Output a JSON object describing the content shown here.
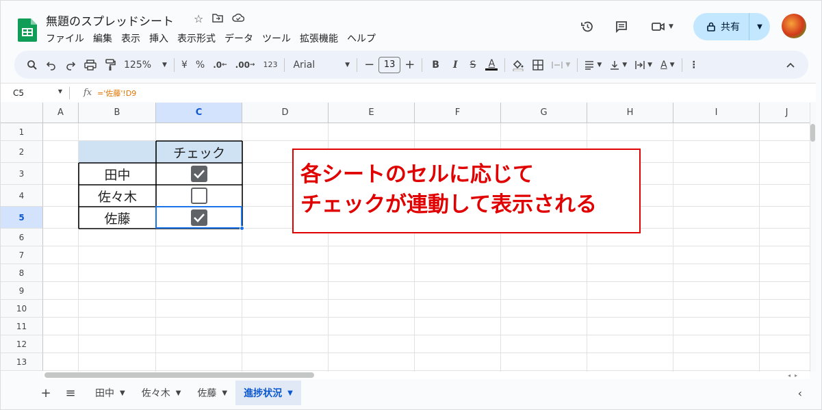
{
  "app": {
    "doc_title": "無題のスプレッドシート",
    "menu": [
      "ファイル",
      "編集",
      "表示",
      "挿入",
      "表示形式",
      "データ",
      "ツール",
      "拡張機能",
      "ヘルプ"
    ],
    "share_label": "共有"
  },
  "toolbar": {
    "zoom": "125%",
    "currency": "¥",
    "percent": "%",
    "decimal_dec": ".0",
    "decimal_inc": ".00",
    "number_format": "123",
    "font": "Arial",
    "font_size": "13",
    "bold": "B",
    "italic": "I",
    "text_color": "A"
  },
  "formula_bar": {
    "cell_ref": "C5",
    "fx": "fx",
    "formula": "='佐藤'!D9"
  },
  "grid": {
    "columns": [
      "A",
      "B",
      "C",
      "D",
      "E",
      "F",
      "G",
      "H",
      "I",
      "J"
    ],
    "rows": [
      "1",
      "2",
      "3",
      "4",
      "5",
      "6",
      "7",
      "8",
      "9",
      "10",
      "11",
      "12",
      "13"
    ],
    "selected_column": "C",
    "selected_row": "5"
  },
  "table": {
    "header": "チェック",
    "rows": [
      {
        "name": "田中",
        "checked": true
      },
      {
        "name": "佐々木",
        "checked": false
      },
      {
        "name": "佐藤",
        "checked": true
      }
    ],
    "header_color": "#cfe2f3"
  },
  "callout": {
    "line1": "各シートのセルに応じて",
    "line2": "チェックが連動して表示される",
    "color": "#e00000"
  },
  "sheets": {
    "tabs": [
      "田中",
      "佐々木",
      "佐藤",
      "進捗状況"
    ],
    "active": "進捗状況"
  }
}
